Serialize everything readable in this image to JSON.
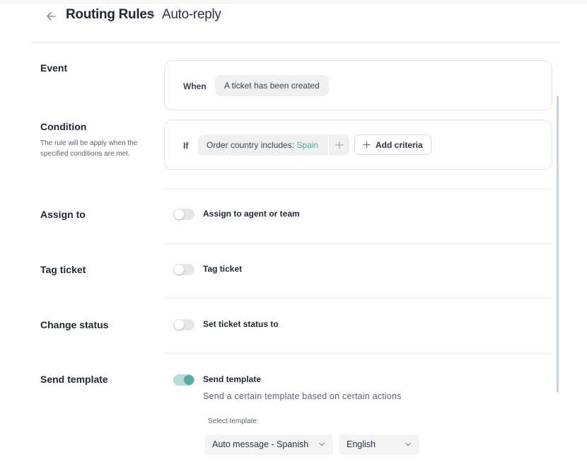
{
  "header": {
    "title": "Routing Rules",
    "breadcrumb_current": "Auto-reply"
  },
  "sections": {
    "event": {
      "label": "Event",
      "keyword": "When",
      "trigger": "A ticket has been created"
    },
    "condition": {
      "label": "Condition",
      "description": "The rule will be apply when the specified conditions are met.",
      "keyword": "If",
      "criteria_field": "Order country includes: ",
      "criteria_value": "Spain",
      "add_criteria_label": "Add criteria"
    },
    "assign": {
      "label": "Assign to",
      "toggle_label": "Assign to agent or team",
      "enabled": false
    },
    "tag": {
      "label": "Tag ticket",
      "toggle_label": "Tag ticket",
      "enabled": false
    },
    "status": {
      "label": "Change status",
      "toggle_label": "Set ticket status to",
      "enabled": false
    },
    "template": {
      "label": "Send template",
      "toggle_label": "Send template",
      "enabled": true,
      "description": "Send a certain template based on certain actions",
      "select_caption": "Select template:",
      "template_value": "Auto message - Spanish",
      "language_value": "English"
    }
  },
  "colors": {
    "accent": "#55a9a0",
    "toggle_on_track": "#b9ded9",
    "toggle_off_track": "#e4e6e9",
    "text_primary": "#1f2733",
    "text_secondary": "#5b6470"
  },
  "icons": {
    "back": "arrow-left-icon",
    "breadcrumb_separator": "chevron-right-icon",
    "add": "plus-icon",
    "dropdown": "chevron-down-icon"
  }
}
